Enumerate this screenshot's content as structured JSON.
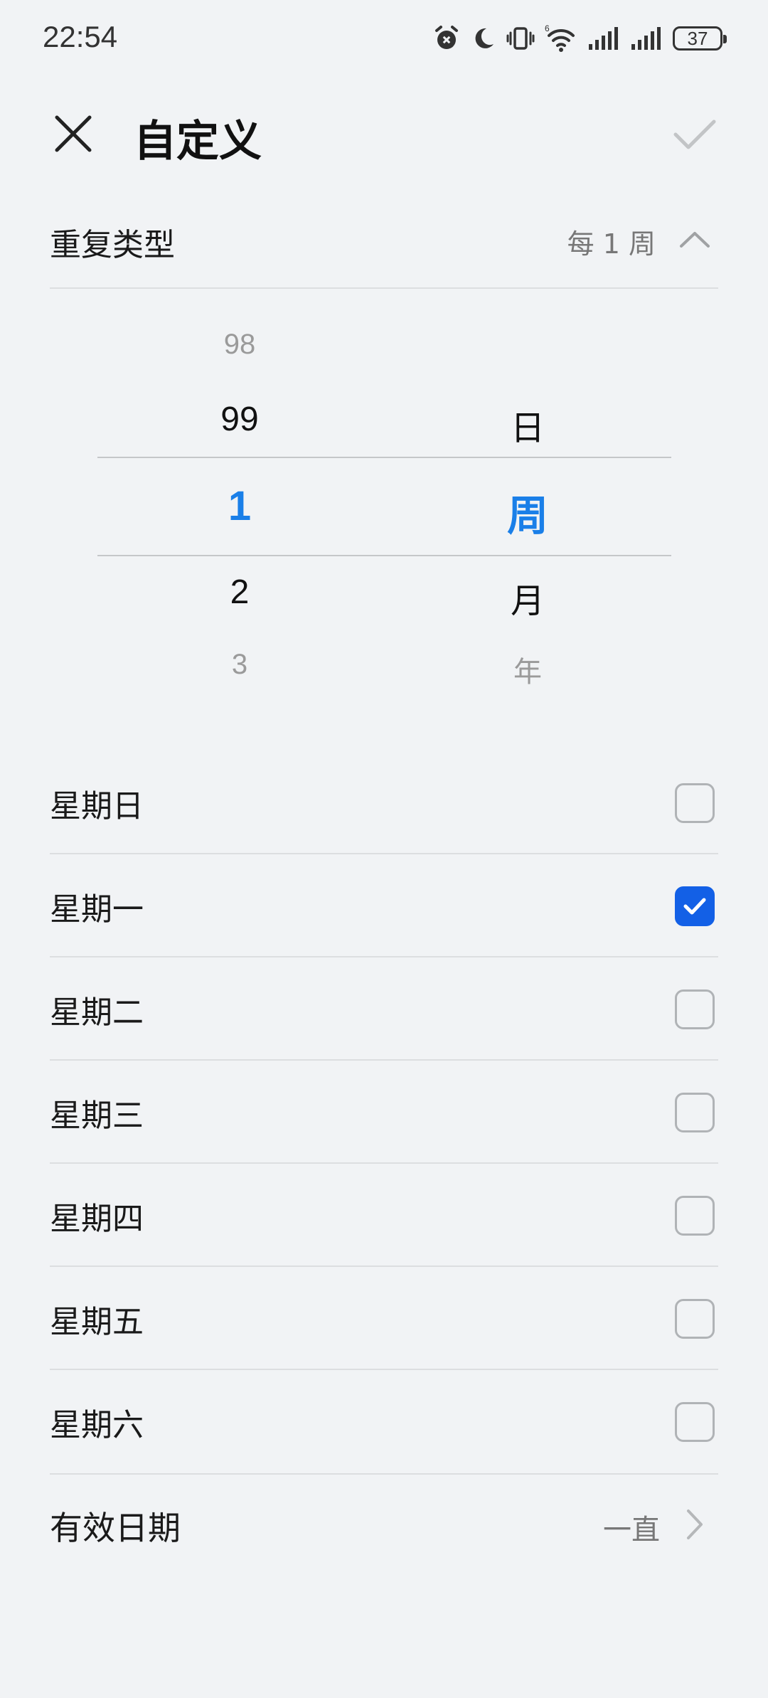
{
  "status_bar": {
    "time": "22:54",
    "battery": "37",
    "icons": [
      "alarm-icon",
      "moon-icon",
      "vibrate-icon",
      "wifi-6-icon",
      "signal-icon",
      "signal-icon"
    ]
  },
  "header": {
    "title": "自定义",
    "close_icon": "close-icon",
    "confirm_icon": "check-icon"
  },
  "repeat": {
    "label": "重复类型",
    "value": "每 1 周",
    "expanded": true
  },
  "picker": {
    "numbers": {
      "far_above": "98",
      "near_above": "99",
      "selected": "1",
      "near_below": "2",
      "far_below": "3"
    },
    "units": {
      "near_above": "日",
      "selected": "周",
      "near_below": "月",
      "far_below": "年"
    }
  },
  "weekdays": [
    {
      "label": "星期日",
      "checked": false
    },
    {
      "label": "星期一",
      "checked": true
    },
    {
      "label": "星期二",
      "checked": false
    },
    {
      "label": "星期三",
      "checked": false
    },
    {
      "label": "星期四",
      "checked": false
    },
    {
      "label": "星期五",
      "checked": false
    },
    {
      "label": "星期六",
      "checked": false
    }
  ],
  "effective_date": {
    "label": "有效日期",
    "value": "一直"
  },
  "colors": {
    "accent": "#1a7fe8",
    "checkbox_checked": "#1360e6",
    "background": "#f1f3f5"
  }
}
